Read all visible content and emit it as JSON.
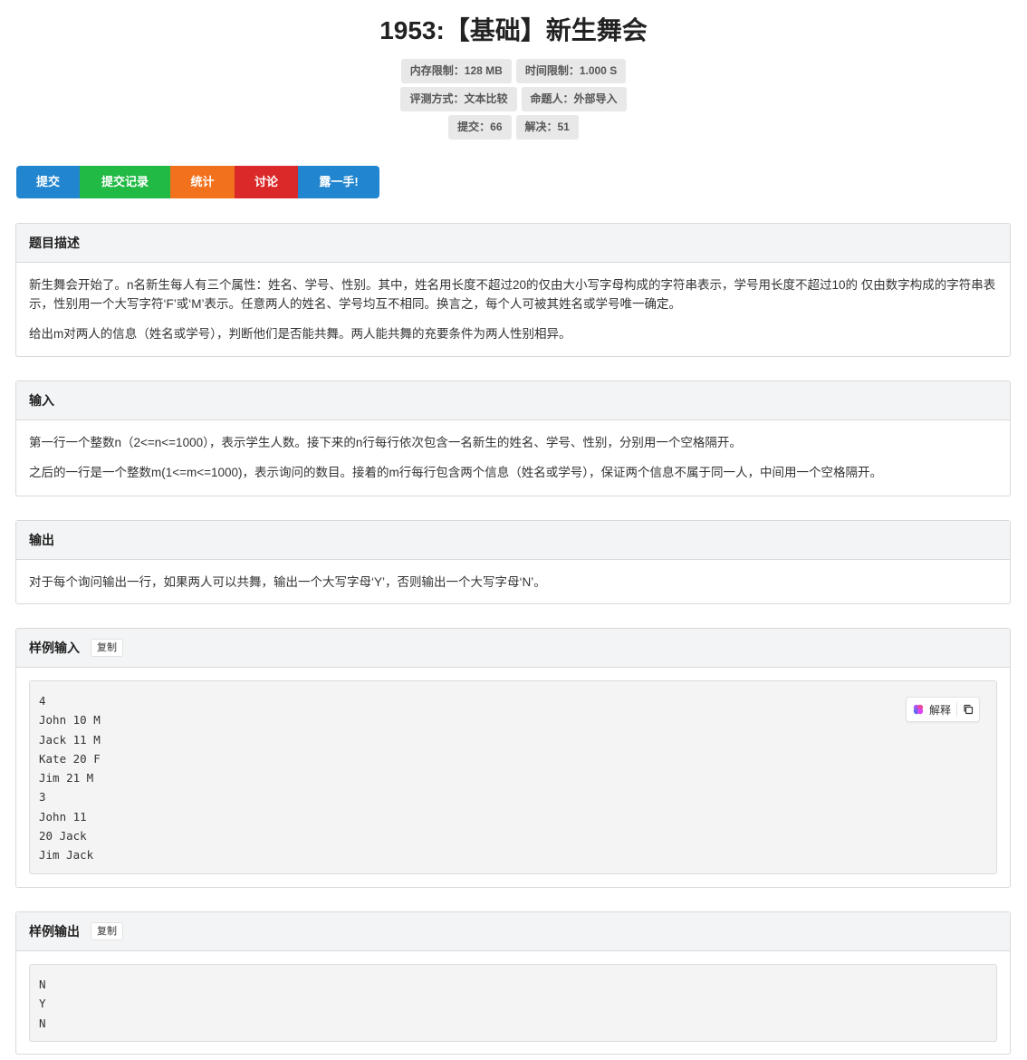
{
  "problem": {
    "title": "1953:【基础】新生舞会",
    "info": {
      "row1": [
        "内存限制：128 MB",
        "时间限制：1.000 S"
      ],
      "row2": [
        "评测方式：文本比较",
        "命题人：外部导入"
      ],
      "row3": [
        "提交：66",
        "解决：51"
      ]
    }
  },
  "buttons": {
    "submit": "提交",
    "records": "提交记录",
    "stats": "统计",
    "discuss": "讨论",
    "show": "露一手!"
  },
  "colors": {
    "blue": "#2185d0",
    "green": "#21ba45",
    "orange": "#f2711c",
    "red": "#db2828"
  },
  "sections": {
    "description": {
      "title": "题目描述",
      "p1": "新生舞会开始了。n名新生每人有三个属性：姓名、学号、性别。其中，姓名用长度不超过20的仅由大小写字母构成的字符串表示，学号用长度不超过10的 仅由数字构成的字符串表示，性别用一个大写字符‘F’或‘M’表示。任意两人的姓名、学号均互不相同。换言之，每个人可被其姓名或学号唯一确定。",
      "p2": "给出m对两人的信息（姓名或学号），判断他们是否能共舞。两人能共舞的充要条件为两人性别相异。"
    },
    "input": {
      "title": "输入",
      "p1": "第一行一个整数n（2<=n<=1000），表示学生人数。接下来的n行每行依次包含一名新生的姓名、学号、性别，分别用一个空格隔开。",
      "p2": "之后的一行是一个整数m(1<=m<=1000)，表示询问的数目。接着的m行每行包含两个信息（姓名或学号），保证两个信息不属于同一人，中间用一个空格隔开。"
    },
    "output": {
      "title": "输出",
      "p1": "对于每个询问输出一行，如果两人可以共舞，输出一个大写字母‘Y’，否则输出一个大写字母‘N’。"
    },
    "sample_input": {
      "title": "样例输入",
      "copy_label": "复制",
      "explain_label": "解释",
      "lines": [
        "4",
        "John 10 M",
        "Jack 11 M",
        "Kate 20 F",
        "Jim 21 M",
        "3",
        "John 11",
        "20 Jack",
        "Jim Jack"
      ]
    },
    "sample_output": {
      "title": "样例输出",
      "copy_label": "复制",
      "lines": [
        "N",
        "Y",
        "N"
      ]
    }
  }
}
